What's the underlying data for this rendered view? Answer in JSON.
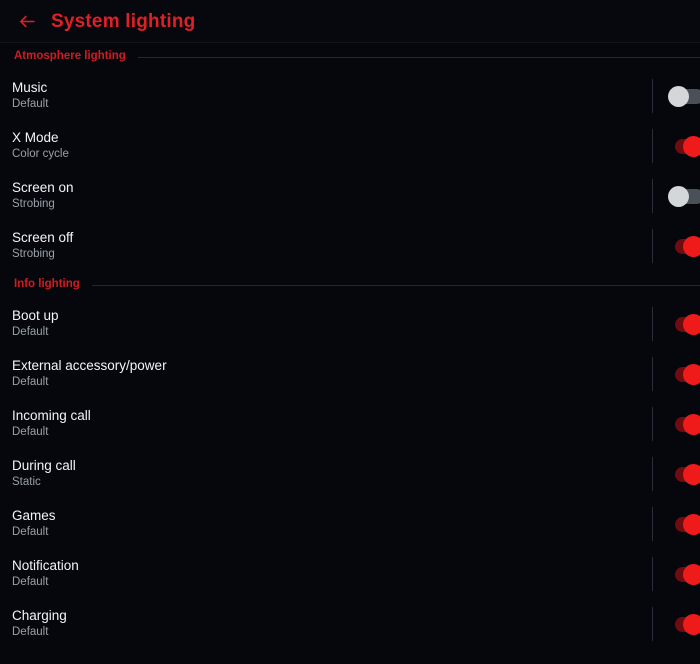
{
  "appbar": {
    "back_icon": "arrow-left-icon",
    "title": "System lighting"
  },
  "colors": {
    "accent_red": "#e01f26",
    "section_red": "#d01c22",
    "rule_red": "#5a1014",
    "switch_on_thumb": "#ef1b1b",
    "switch_on_track": "#6e0c10",
    "switch_off_thumb": "#d4d7da",
    "switch_off_track": "#4a5058",
    "background": "#05070c",
    "title_text": "#f2f5f8",
    "subtitle_text": "#9aa0a8"
  },
  "sections": [
    {
      "label": "Atmosphere lighting",
      "rows": [
        {
          "title": "Music",
          "subtitle": "Default",
          "state": "off"
        },
        {
          "title": "X Mode",
          "subtitle": "Color cycle",
          "state": "on"
        },
        {
          "title": "Screen on",
          "subtitle": "Strobing",
          "state": "off"
        },
        {
          "title": "Screen off",
          "subtitle": "Strobing",
          "state": "on"
        }
      ]
    },
    {
      "label": "Info lighting",
      "rows": [
        {
          "title": "Boot up",
          "subtitle": "Default",
          "state": "on"
        },
        {
          "title": "External accessory/power",
          "subtitle": "Default",
          "state": "on"
        },
        {
          "title": "Incoming call",
          "subtitle": "Default",
          "state": "on"
        },
        {
          "title": "During call",
          "subtitle": "Static",
          "state": "on"
        },
        {
          "title": "Games",
          "subtitle": "Default",
          "state": "on"
        },
        {
          "title": "Notification",
          "subtitle": "Default",
          "state": "on"
        },
        {
          "title": "Charging",
          "subtitle": "Default",
          "state": "on"
        }
      ]
    }
  ]
}
